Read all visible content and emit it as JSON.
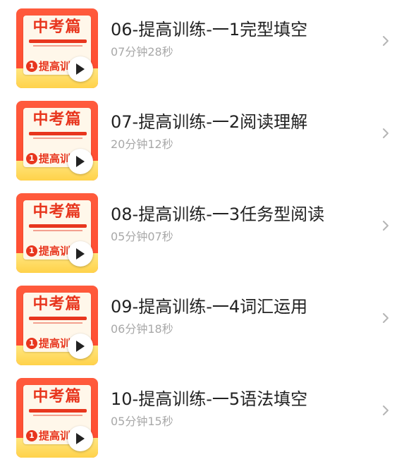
{
  "thumbnail": {
    "title": "中考篇",
    "number": "1",
    "tag": "提高训",
    "colors": {
      "red": "#ff4a2e",
      "yellow": "#ffd24a",
      "text": "#e8361e"
    }
  },
  "lessons": [
    {
      "title": "06-提高训练-一1完型填空",
      "duration": "07分钟28秒"
    },
    {
      "title": "07-提高训练-一2阅读理解",
      "duration": "20分钟12秒"
    },
    {
      "title": "08-提高训练-一3任务型阅读",
      "duration": "05分钟07秒"
    },
    {
      "title": "09-提高训练-一4词汇运用",
      "duration": "06分钟18秒"
    },
    {
      "title": "10-提高训练-一5语法填空",
      "duration": "05分钟15秒"
    }
  ],
  "icons": {
    "play": "play-icon",
    "chevron": "chevron-right-icon"
  },
  "colors": {
    "title": "#222222",
    "duration": "#a8a8a8",
    "chevron": "#b5b5b5"
  }
}
